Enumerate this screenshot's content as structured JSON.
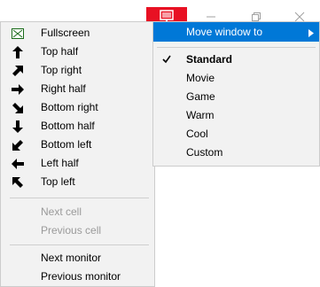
{
  "main_menu": {
    "items": [
      {
        "label": "Fullscreen",
        "icon": "fullscreen-icon"
      },
      {
        "label": "Top half",
        "icon": "arrow-up-icon"
      },
      {
        "label": "Top right",
        "icon": "arrow-up-right-icon"
      },
      {
        "label": "Right half",
        "icon": "arrow-right-icon"
      },
      {
        "label": "Bottom right",
        "icon": "arrow-down-right-icon"
      },
      {
        "label": "Bottom half",
        "icon": "arrow-down-icon"
      },
      {
        "label": "Bottom left",
        "icon": "arrow-down-left-icon"
      },
      {
        "label": "Left half",
        "icon": "arrow-left-icon"
      },
      {
        "label": "Top left",
        "icon": "arrow-up-left-icon"
      }
    ],
    "cell_items": [
      {
        "label": "Next cell",
        "disabled": true
      },
      {
        "label": "Previous cell",
        "disabled": true
      }
    ],
    "monitor_items": [
      {
        "label": "Next monitor"
      },
      {
        "label": "Previous monitor"
      }
    ]
  },
  "sub_menu": {
    "header": "Move window to",
    "items": [
      {
        "label": "Standard",
        "checked": true
      },
      {
        "label": "Movie"
      },
      {
        "label": "Game"
      },
      {
        "label": "Warm"
      },
      {
        "label": "Cool"
      },
      {
        "label": "Custom"
      }
    ]
  },
  "colors": {
    "highlight": "#0078d7",
    "monitor_button": "#e81123",
    "menu_bg": "#f2f2f2",
    "disabled_text": "#9a9a9a"
  }
}
